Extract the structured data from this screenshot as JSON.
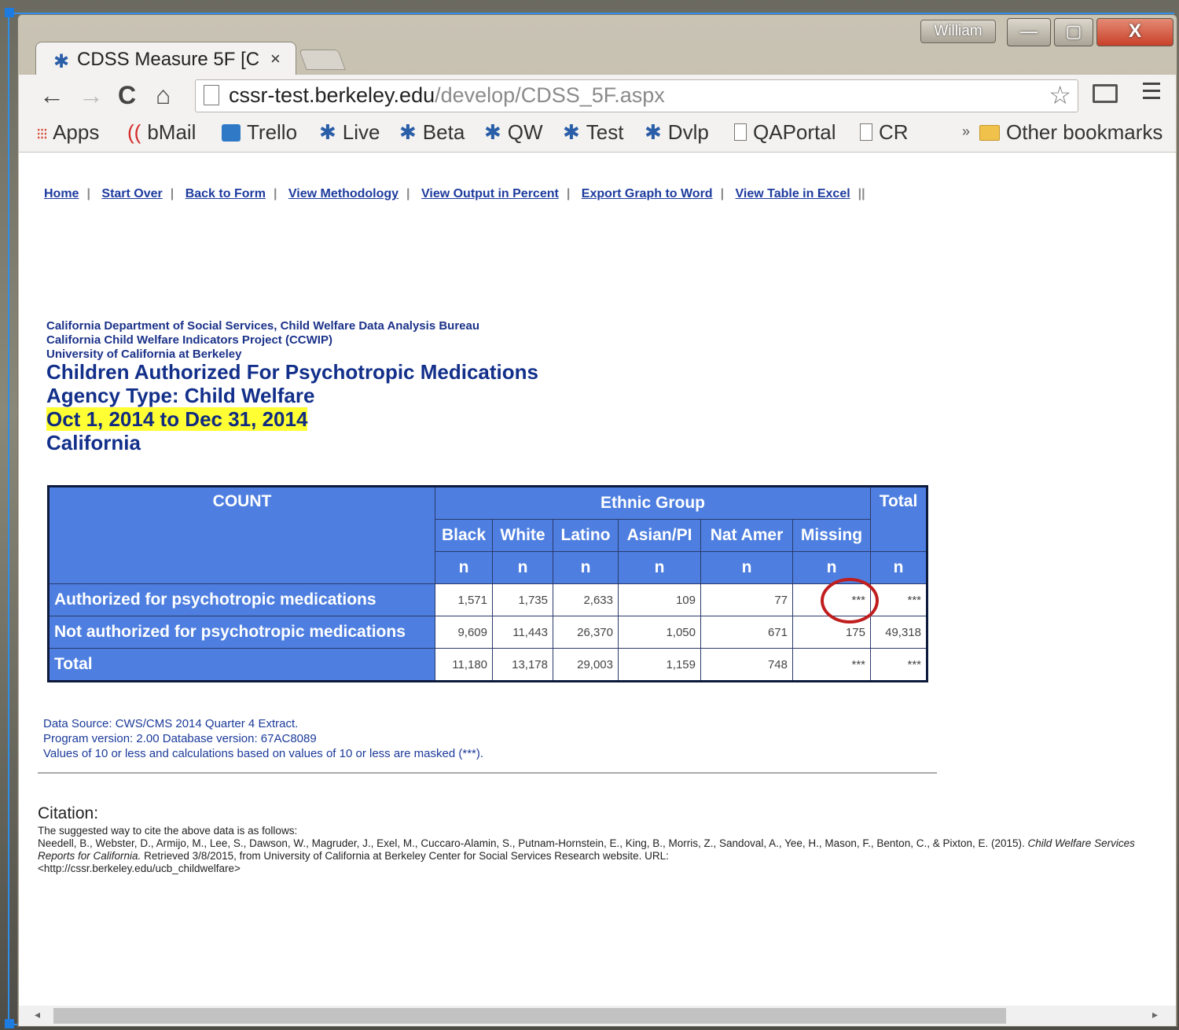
{
  "window": {
    "user_badge": "William",
    "minimize": "—",
    "maximize": "▢",
    "close": "X"
  },
  "tab": {
    "title": "CDSS Measure 5F [C",
    "close": "×"
  },
  "toolbar": {
    "back": "←",
    "forward": "→",
    "reload": "C",
    "home": "⌂",
    "url_host": "cssr-test.berkeley.edu",
    "url_path": "/develop/CDSS_5F.aspx",
    "star": "☆"
  },
  "bookmarks": {
    "items": [
      "Apps",
      "bMail",
      "Trello",
      "Live",
      "Beta",
      "QW",
      "Test",
      "Dvlp",
      "QAPortal",
      "CR"
    ],
    "more": "»",
    "other": "Other bookmarks"
  },
  "nav_links": [
    "Home",
    "Start Over",
    "Back to Form",
    "View Methodology",
    "View Output in Percent",
    "Export Graph to Word",
    "View Table in Excel"
  ],
  "header": {
    "org1": "California Department of Social Services, Child Welfare Data Analysis Bureau",
    "org2": "California Child Welfare Indicators Project (CCWIP)",
    "org3": "University of California at Berkeley",
    "title": "Children Authorized For Psychotropic Medications",
    "agency": "Agency Type: Child Welfare",
    "date_range": "Oct 1, 2014 to Dec 31, 2014",
    "region": "California"
  },
  "table": {
    "corner": "COUNT",
    "group_header": "Ethnic Group",
    "total_header": "Total",
    "columns": [
      "Black",
      "White",
      "Latino",
      "Asian/PI",
      "Nat Amer",
      "Missing"
    ],
    "unit": "n",
    "rows": [
      {
        "label": "Authorized for psychotropic medications",
        "values": [
          "1,571",
          "1,735",
          "2,633",
          "109",
          "77",
          "***",
          "***"
        ]
      },
      {
        "label": "Not authorized for psychotropic medications",
        "values": [
          "9,609",
          "11,443",
          "26,370",
          "1,050",
          "671",
          "175",
          "49,318"
        ]
      },
      {
        "label": "Total",
        "values": [
          "11,180",
          "13,178",
          "29,003",
          "1,159",
          "748",
          "***",
          "***"
        ]
      }
    ]
  },
  "notes": {
    "source": "Data Source: CWS/CMS 2014 Quarter 4 Extract.",
    "version": "Program version: 2.00 Database version: 67AC8089",
    "mask": "Values of 10 or less and calculations based on values of 10 or less are masked (***)."
  },
  "citation": {
    "heading": "Citation:",
    "intro": "The suggested way to cite the above data is as follows:",
    "authors": "Needell, B., Webster, D., Armijo, M., Lee, S., Dawson, W., Magruder, J., Exel, M., Cuccaro-Alamin, S., Putnam-Hornstein, E., King, B., Morris, Z., Sandoval, A., Yee, H., Mason, F., Benton, C., & Pixton, E. (2015).",
    "work": "Child Welfare Services Reports for California.",
    "retrieved": "Retrieved 3/8/2015, from University of California at Berkeley Center for Social Services Research website. URL:",
    "url": "<http://cssr.berkeley.edu/ucb_childwelfare>"
  },
  "scrollbar": {
    "left": "◂",
    "right": "▸"
  }
}
